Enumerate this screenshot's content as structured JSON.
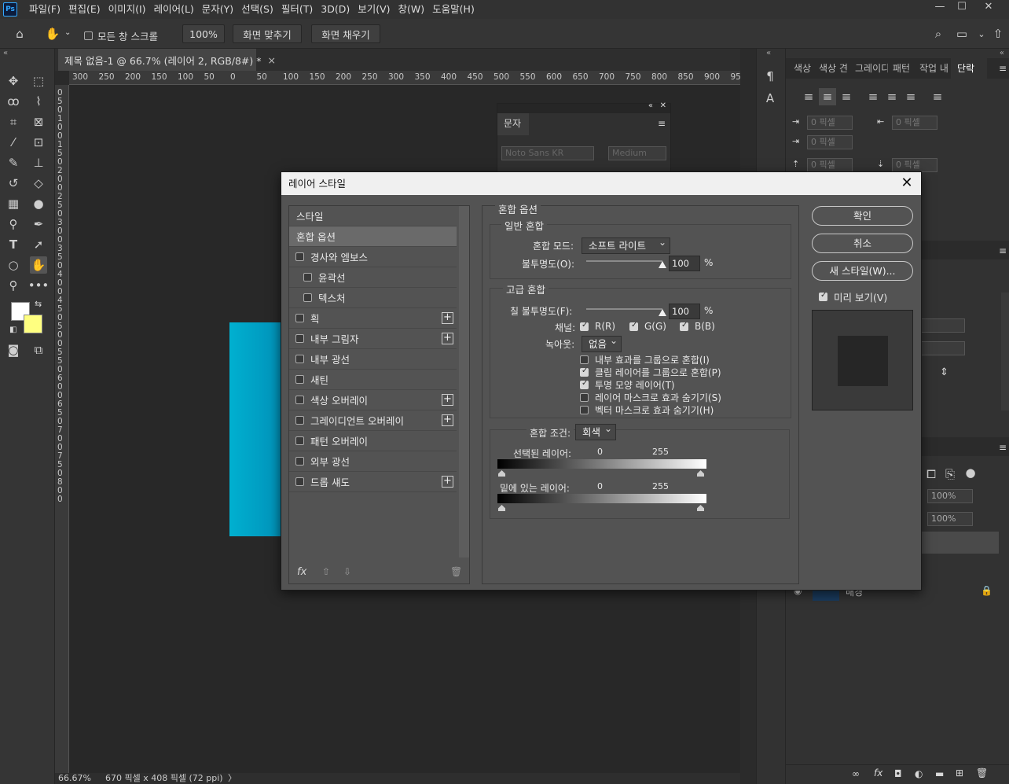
{
  "app": {
    "logo": "Ps",
    "menus": [
      "파일(F)",
      "편집(E)",
      "이미지(I)",
      "레이어(L)",
      "문자(Y)",
      "선택(S)",
      "필터(T)",
      "3D(D)",
      "보기(V)",
      "창(W)",
      "도움말(H)"
    ],
    "window_controls": [
      "—",
      "☐",
      "✕"
    ]
  },
  "options_bar": {
    "scroll_all_label": "모든 창 스크롤",
    "scroll_all_checked": false,
    "zoom_value": "100%",
    "fit_screen": "화면 맞추기",
    "fill_screen": "화면 채우기"
  },
  "document": {
    "tab_title": "제목 없음-1 @ 66.7% (레이어 2, RGB/8#) *",
    "ruler_h": [
      "300",
      "250",
      "200",
      "150",
      "100",
      "50",
      "0",
      "50",
      "100",
      "150",
      "200",
      "250",
      "300",
      "350",
      "400",
      "450",
      "500",
      "550",
      "600",
      "650",
      "700",
      "750",
      "800",
      "850",
      "900",
      "950"
    ],
    "ruler_v": [
      "0",
      "5",
      "0",
      "1",
      "0",
      "0",
      "1",
      "5",
      "0",
      "2",
      "0",
      "0",
      "2",
      "5",
      "0",
      "3",
      "0",
      "0",
      "3",
      "5",
      "0",
      "4",
      "0",
      "0",
      "4",
      "5",
      "0",
      "5",
      "0",
      "0",
      "5",
      "5",
      "0",
      "6",
      "0",
      "0",
      "6",
      "5",
      "0",
      "7",
      "0",
      "0",
      "7",
      "5",
      "0",
      "8",
      "0",
      "0"
    ],
    "status_zoom": "66.67%",
    "status_size": "670 픽셀 x 408 픽셀 (72 ppi)",
    "status_arrow": "〉"
  },
  "character_panel": {
    "title": "문자",
    "font": "Noto Sans KR",
    "weight": "Medium"
  },
  "right_panel": {
    "tabs": [
      "색상",
      "색상 견",
      "그레이디",
      "패턴",
      "작업 내",
      "단락"
    ],
    "active_tab": "단락",
    "indent_placeholder": "0 픽셀"
  },
  "dialog": {
    "title": "레이어 스타일",
    "close": "✕",
    "styles_header": "스타일",
    "blend_options_item": "혼합 옵션",
    "items": [
      {
        "label": "경사와 엠보스",
        "checked": false,
        "indent": false,
        "plus": false
      },
      {
        "label": "윤곽선",
        "checked": false,
        "indent": true,
        "plus": false
      },
      {
        "label": "텍스처",
        "checked": false,
        "indent": true,
        "plus": false
      },
      {
        "label": "획",
        "checked": false,
        "indent": false,
        "plus": true
      },
      {
        "label": "내부 그림자",
        "checked": false,
        "indent": false,
        "plus": true
      },
      {
        "label": "내부 광선",
        "checked": false,
        "indent": false,
        "plus": false
      },
      {
        "label": "새틴",
        "checked": false,
        "indent": false,
        "plus": false
      },
      {
        "label": "색상 오버레이",
        "checked": false,
        "indent": false,
        "plus": true
      },
      {
        "label": "그레이디언트 오버레이",
        "checked": false,
        "indent": false,
        "plus": true
      },
      {
        "label": "패턴 오버레이",
        "checked": false,
        "indent": false,
        "plus": false
      },
      {
        "label": "외부 광선",
        "checked": false,
        "indent": false,
        "plus": false
      },
      {
        "label": "드롭 섀도",
        "checked": false,
        "indent": false,
        "plus": true
      }
    ],
    "footer_fx": "fx",
    "blend": {
      "section_title": "혼합 옵션",
      "general_title": "일반 혼합",
      "blend_mode_label": "혼합 모드:",
      "blend_mode_value": "소프트 라이트",
      "opacity_label": "불투명도(O):",
      "opacity_value": "100",
      "opacity_fraction": 1.0,
      "percent": "%",
      "advanced_title": "고급 혼합",
      "fill_opacity_label": "칠 불투명도(F):",
      "fill_opacity_value": "100",
      "fill_opacity_fraction": 1.0,
      "channels_label": "채널:",
      "channels": [
        {
          "label": "R(R)",
          "checked": true
        },
        {
          "label": "G(G)",
          "checked": true
        },
        {
          "label": "B(B)",
          "checked": true
        }
      ],
      "knockout_label": "녹아웃:",
      "knockout_value": "없음",
      "options": [
        {
          "label": "내부 효과를 그룹으로 혼합(I)",
          "checked": false
        },
        {
          "label": "클립 레이어를 그룹으로 혼합(P)",
          "checked": true
        },
        {
          "label": "투명 모양 레이어(T)",
          "checked": true
        },
        {
          "label": "레이어 마스크로 효과 숨기기(S)",
          "checked": false
        },
        {
          "label": "벡터 마스크로 효과 숨기기(H)",
          "checked": false
        }
      ],
      "blend_if_label": "혼합 조건:",
      "blend_if_value": "회색",
      "this_layer_label": "선택된 레이어:",
      "underlying_label": "밑에 있는 레이어:",
      "range_min": "0",
      "range_max": "255"
    },
    "buttons": {
      "ok": "확인",
      "cancel": "취소",
      "new_style": "새 스타일(W)...",
      "preview_label": "미리 보기(V)",
      "preview_checked": true
    }
  },
  "layers": {
    "background_name": "배경",
    "opacity_value": "100%",
    "fill_value": "100%"
  },
  "colors": {
    "accent": "#31a8ff",
    "foreground": "#ffffff",
    "background": "#ffff80",
    "canvas_layer": "#00a8c8"
  }
}
